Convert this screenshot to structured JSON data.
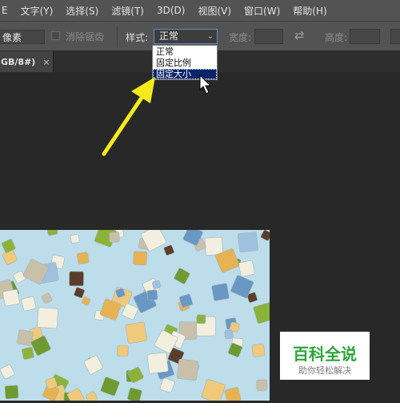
{
  "menubar": {
    "items": [
      "文字(Y)",
      "选择(S)",
      "滤镜(T)",
      "3D(D)",
      "视图(V)",
      "窗口(W)",
      "帮助(H)"
    ],
    "leading_fragment": "E"
  },
  "options_bar": {
    "unit_value": "像素",
    "antialias_label": "消除锯齿",
    "antialias_checked": false,
    "style_label": "样式:",
    "style_value": "正常",
    "width_label": "宽度:",
    "width_value": "",
    "swap_icon": "swap-arrows-icon",
    "height_label": "高度:",
    "height_value": ""
  },
  "document_tab": {
    "label": "GB/8#)",
    "close_symbol": "×"
  },
  "style_dropdown": {
    "options": [
      "正常",
      "固定比例",
      "固定大小"
    ],
    "highlighted_option": "固定大小"
  },
  "annotation": {
    "arrow_color": "#f5ea1d",
    "arrow_target": "固定大小"
  },
  "watermark": {
    "main": "百科全说",
    "sub": "助你轻松解决",
    "color": "#2ea43a"
  },
  "canvas": {
    "background_color": "#bcdde9",
    "pattern": "scattered-squares"
  },
  "colors": {
    "menubar_bg": "#535353",
    "workspace_bg": "#282828",
    "highlight": "#0a246a",
    "select_border": "#5c8fcb"
  }
}
